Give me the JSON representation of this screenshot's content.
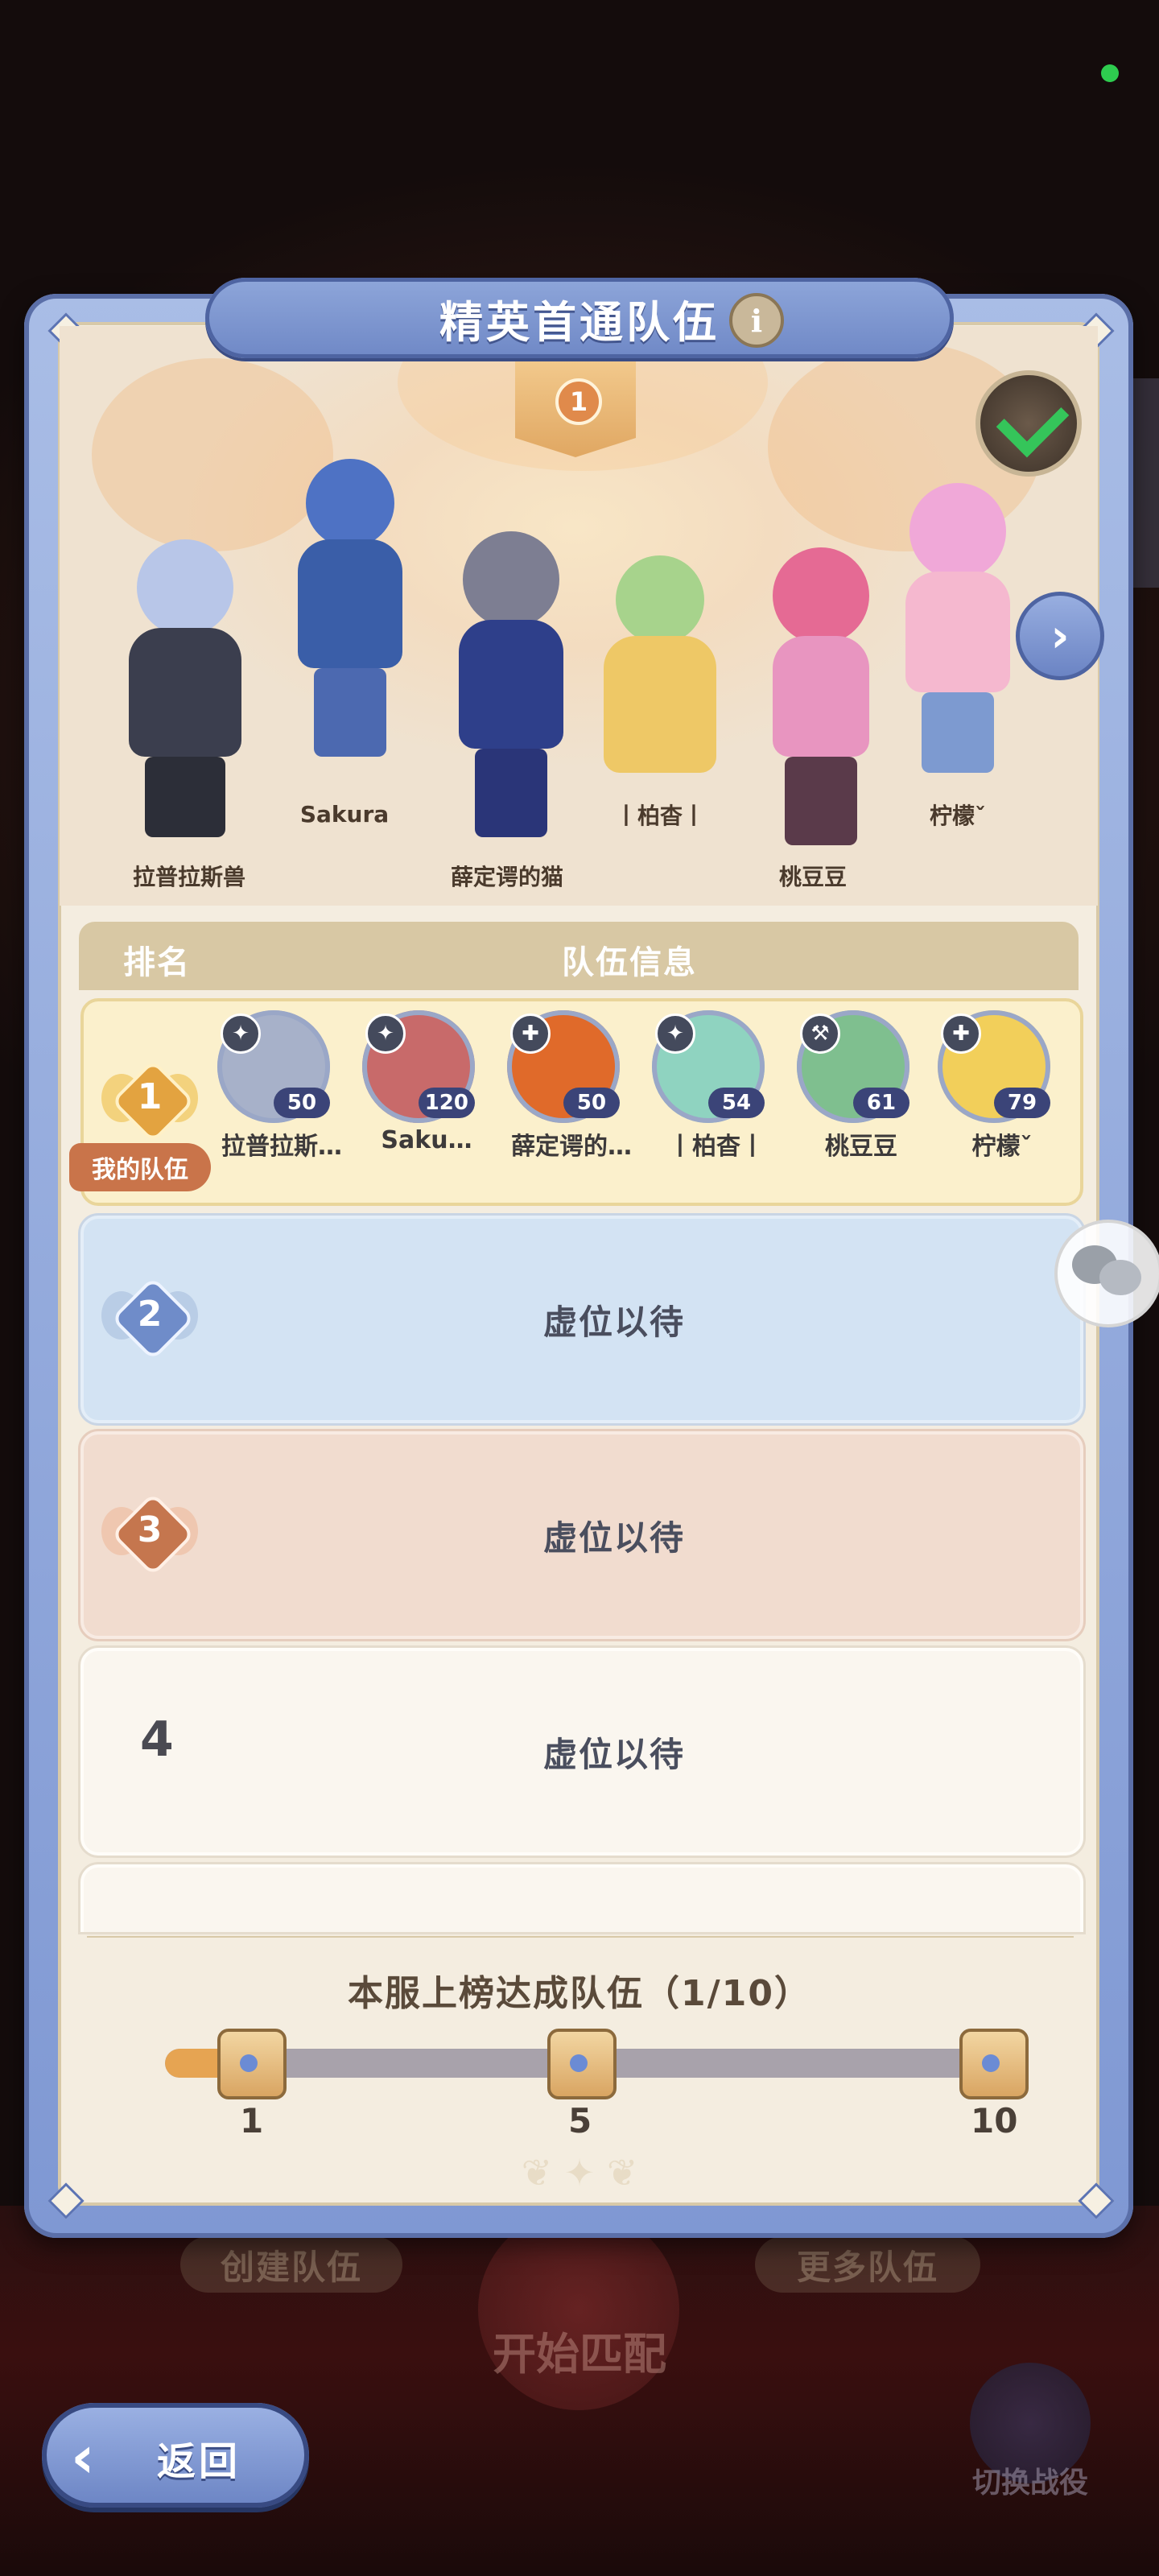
{
  "panel": {
    "title": "精英首通队伍",
    "info_symbol": "i",
    "showcase_rank": "1"
  },
  "showcase": {
    "characters": [
      {
        "name": "拉普拉斯兽"
      },
      {
        "name": "Sakura"
      },
      {
        "name": "薛定谔的猫"
      },
      {
        "name": "丨柏杳丨"
      },
      {
        "name": "桃豆豆"
      },
      {
        "name": "柠檬ˇ"
      }
    ]
  },
  "table": {
    "col_rank": "排名",
    "col_team": "队伍信息"
  },
  "my_team": {
    "rank": "1",
    "tag": "我的队伍",
    "members": [
      {
        "name": "拉普拉斯…",
        "level": "50",
        "color": "#a7b1c9"
      },
      {
        "name": "Saku…",
        "level": "120",
        "color": "#c86a6a"
      },
      {
        "name": "薛定谔的…",
        "level": "50",
        "color": "#e06a2a"
      },
      {
        "name": "丨柏杳丨",
        "level": "54",
        "color": "#8fd3c0"
      },
      {
        "name": "桃豆豆",
        "level": "61",
        "color": "#7fbf8f"
      },
      {
        "name": "柠檬ˇ",
        "level": "79",
        "color": "#f2cf5a"
      }
    ]
  },
  "rows": [
    {
      "rank": "2",
      "text": "虚位以待"
    },
    {
      "rank": "3",
      "text": "虚位以待"
    },
    {
      "rank": "4",
      "text": "虚位以待"
    }
  ],
  "progress": {
    "title": "本服上榜达成队伍（1/10）",
    "current": 1,
    "total": 10,
    "milestones": [
      "1",
      "5",
      "10"
    ]
  },
  "background": {
    "create_team": "创建队伍",
    "more_teams": "更多队伍",
    "start_match": "开始匹配",
    "switch_campaign": "切换战役"
  },
  "back_button": {
    "label": "返回"
  },
  "colors": {
    "accent_blue": "#7f98d3",
    "progress_fill": "#e6a452",
    "status_online": "#2ecc4f"
  }
}
